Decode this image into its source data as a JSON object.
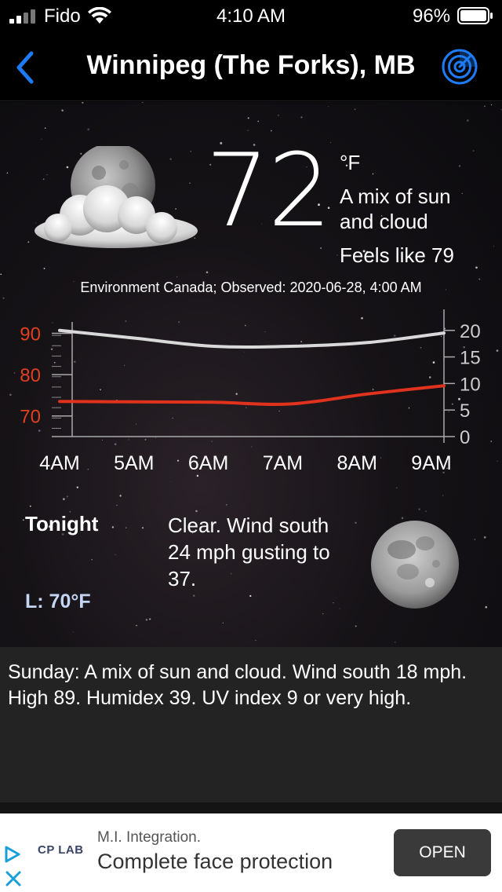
{
  "status_bar": {
    "carrier": "Fido",
    "time": "4:10 AM",
    "battery": "96%"
  },
  "nav": {
    "title": "Winnipeg (The Forks), MB",
    "back_icon": "chevron-left-icon",
    "radar_icon": "radar-icon",
    "accent_color": "#1e7bf6"
  },
  "current": {
    "temperature": "72",
    "unit": "°F",
    "condition": "A mix of sun and cloud",
    "feels_like": "Feels like 79",
    "source": "Environment Canada; Observed: 2020-06-28, 4:00 AM",
    "icon": "cloud-moon-icon"
  },
  "chart_data": {
    "type": "line",
    "categories": [
      "4AM",
      "5AM",
      "6AM",
      "7AM",
      "8AM",
      "9AM"
    ],
    "series": [
      {
        "color": "#d9d9d9",
        "axis": "right",
        "values": [
          20,
          18.5,
          17,
          17,
          17.7,
          19.5
        ]
      },
      {
        "color": "#e0321c",
        "axis": "left",
        "values": [
          73.5,
          73.4,
          73.3,
          72.9,
          75.3,
          77.3
        ]
      }
    ],
    "y_left": {
      "ticks": [
        "90",
        "80",
        "70"
      ],
      "ylim": [
        65,
        92
      ],
      "color": "#e0401f"
    },
    "y_right": {
      "ticks": [
        "20",
        "15",
        "10",
        "5",
        "0"
      ],
      "ylim": [
        0,
        21
      ],
      "color": "#cccccc"
    }
  },
  "tonight": {
    "label": "Tonight",
    "text": "Clear. Wind south 24 mph gusting to 37.",
    "low": "L: 70°F",
    "icon": "full-moon-icon"
  },
  "forecast": {
    "text": "Sunday:  A mix of sun and cloud. Wind south 18 mph. High 89. Humidex 39. UV index 9 or very high."
  },
  "ad": {
    "logo": "CP LAB",
    "subtitle": "M.I. Integration.",
    "headline": "Complete face protection",
    "button": "OPEN"
  }
}
